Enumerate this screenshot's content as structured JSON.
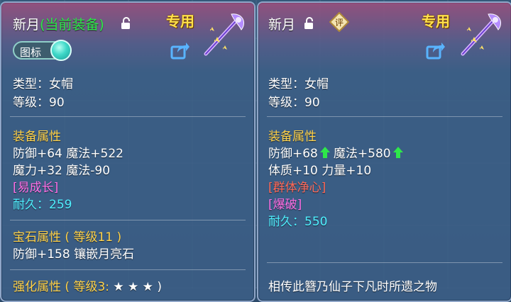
{
  "left": {
    "name": "新月",
    "equipped_label": "(当前装备)",
    "exclusive_tag": "专用",
    "icon_toggle_label": "图标",
    "type_line": "类型：女帽",
    "level_line": "等级：90",
    "equip_attr_title": "装备属性",
    "attr_line1": "防御+64 魔法+522",
    "attr_line2": "魔力+32 魔法-90",
    "special": "[易成长]",
    "durability_label": "耐久：",
    "durability_value": "259",
    "gem_title": "宝石属性 ( 等级11 )",
    "gem_line": "防御+158 镶嵌月亮石",
    "enhance_title": "强化属性 ( 等级3:",
    "enhance_stars": "★ ★ ★ )"
  },
  "right": {
    "name": "新月",
    "rate_badge": "评",
    "exclusive_tag": "专用",
    "type_line": "类型：女帽",
    "level_line": "等级：90",
    "equip_attr_title": "装备属性",
    "attr_defense": "防御+68",
    "attr_magic": "魔法+580",
    "attr_line2": "体质+10 力量+10",
    "special1": "[群体净心]",
    "special2": "[爆破]",
    "durability_label": "耐久：",
    "durability_value": "550",
    "description": "相传此簪乃仙子下凡时所遗之物"
  },
  "colors": {
    "green": "#2ee84a",
    "yellow_title": "#ffd24a",
    "purple": "#ff6fe6",
    "red": "#ff6a5a",
    "cyan": "#4ff0ff",
    "tag_gold": "#ffe14a"
  }
}
